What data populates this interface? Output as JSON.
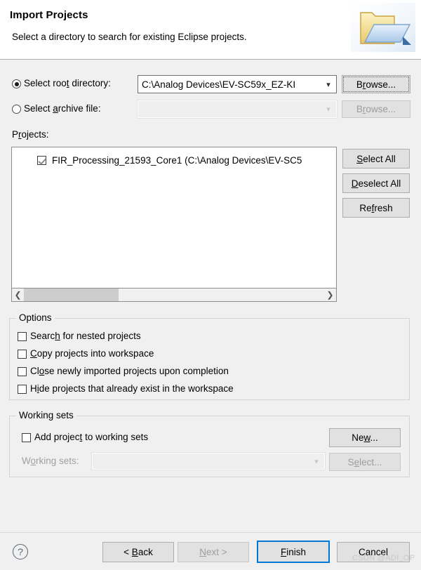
{
  "header": {
    "title": "Import Projects",
    "description": "Select a directory to search for existing Eclipse projects.",
    "icon": "import-folder-icon"
  },
  "source": {
    "root_directory": {
      "radio_label_pre": "Select roo",
      "radio_label_mnemonic": "t",
      "radio_label_post": " directory:",
      "label_full": "Select root directory:",
      "selected": true,
      "value": "C:\\Analog Devices\\EV-SC59x_EZ-KI",
      "browse_pre": "B",
      "browse_mnemonic": "r",
      "browse_post": "owse...",
      "browse_label": "Browse..."
    },
    "archive_file": {
      "radio_label_pre": "Select ",
      "radio_label_mnemonic": "a",
      "radio_label_post": "rchive file:",
      "label_full": "Select archive file:",
      "selected": false,
      "value": "",
      "browse_pre": "B",
      "browse_mnemonic": "r",
      "browse_post": "owse...",
      "browse_label": "Browse...",
      "enabled": false
    }
  },
  "projects": {
    "label_pre": "P",
    "label_mnemonic": "r",
    "label_post": "ojects:",
    "label_full": "Projects:",
    "items": [
      {
        "checked": true,
        "name": "FIR_Processing_21593_Core1 (C:\\Analog Devices\\EV-SC5"
      }
    ],
    "buttons": {
      "select_all": {
        "pre": "",
        "mnemonic": "S",
        "post": "elect All",
        "label": "Select All"
      },
      "deselect_all": {
        "pre": "",
        "mnemonic": "D",
        "post": "eselect All",
        "label": "Deselect All"
      },
      "refresh": {
        "pre": "Re",
        "mnemonic": "f",
        "post": "resh",
        "label": "Refresh"
      }
    },
    "scrollbar": {
      "left_arrow": "chevron-left-icon",
      "right_arrow": "chevron-right-icon"
    }
  },
  "options": {
    "title": "Options",
    "items": [
      {
        "pre": "Searc",
        "mnemonic": "h",
        "post": " for nested projects",
        "label": "Search for nested projects",
        "checked": false
      },
      {
        "pre": "",
        "mnemonic": "C",
        "post": "opy projects into workspace",
        "label": "Copy projects into workspace",
        "checked": false
      },
      {
        "pre": "Cl",
        "mnemonic": "o",
        "post": "se newly imported projects upon completion",
        "label": "Close newly imported projects upon completion",
        "checked": false
      },
      {
        "pre": "H",
        "mnemonic": "i",
        "post": "de projects that already exist in the workspace",
        "label": "Hide projects that already exist in the workspace",
        "checked": false
      }
    ]
  },
  "working_sets": {
    "title": "Working sets",
    "add_checkbox": {
      "pre": "Add projec",
      "mnemonic": "t",
      "post": " to working sets",
      "label": "Add project to working sets",
      "checked": false
    },
    "new_button": {
      "pre": "Ne",
      "mnemonic": "w",
      "post": "...",
      "label": "New..."
    },
    "combo_label": {
      "pre": "W",
      "mnemonic": "o",
      "post": "rking sets:",
      "label": "Working sets:",
      "enabled": false
    },
    "combo_value": "",
    "select_button": {
      "pre": "S",
      "mnemonic": "e",
      "post": "lect...",
      "label": "Select...",
      "enabled": false
    }
  },
  "footer": {
    "help_icon": "help-question-icon",
    "back": {
      "pre": "< ",
      "mnemonic": "B",
      "post": "ack",
      "label": "< Back",
      "enabled": true
    },
    "next": {
      "pre": "",
      "mnemonic": "N",
      "post": "ext >",
      "label": "Next >",
      "enabled": false
    },
    "finish": {
      "pre": "",
      "mnemonic": "F",
      "post": "inish",
      "label": "Finish",
      "enabled": true,
      "default": true
    },
    "cancel": {
      "pre": "Cancel",
      "mnemonic": "",
      "post": "",
      "label": "Cancel",
      "enabled": true
    }
  },
  "watermark": "CSDN @ADI_OP",
  "colors": {
    "dialog_background": "#f0f0f0",
    "header_background": "#ffffff",
    "accent_focus": "#0078d7",
    "button_face": "#e1e1e1",
    "disabled_text": "#9d9d9d"
  }
}
